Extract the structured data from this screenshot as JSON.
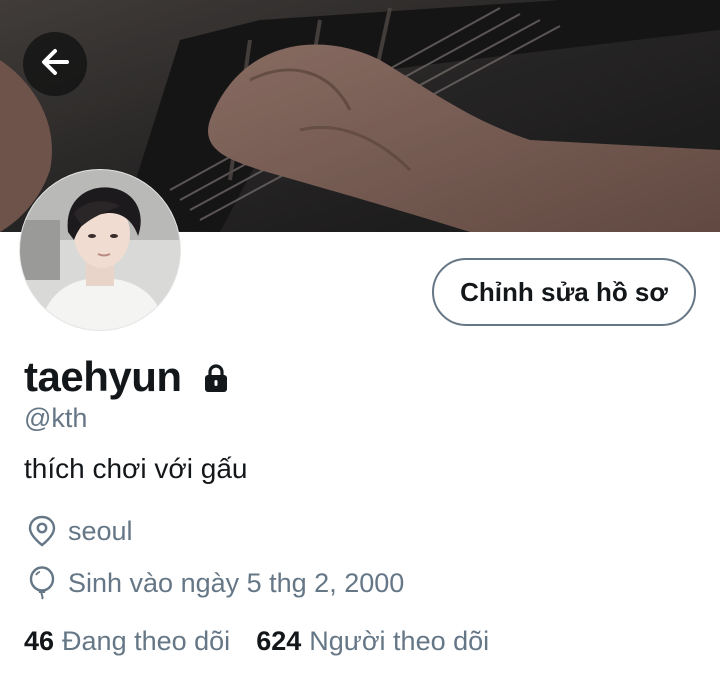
{
  "profile": {
    "display_name": "taehyun",
    "handle": "@kth",
    "bio": "thích chơi với gấu",
    "location": "seoul",
    "birthday": "Sinh vào ngày 5 thg 2, 2000",
    "protected_icon": "lock-icon",
    "edit_button_label": "Chỉnh sửa hồ sơ"
  },
  "stats": {
    "following_count": "46",
    "following_label": "Đang theo dõi",
    "followers_count": "624",
    "followers_label": "Người theo dõi"
  },
  "icons": {
    "back": "arrow-left-icon",
    "location": "location-pin-icon",
    "birthday": "balloon-icon"
  },
  "colors": {
    "text_primary": "#14171a",
    "text_secondary": "#657786",
    "button_border": "#657786",
    "background": "#ffffff"
  }
}
